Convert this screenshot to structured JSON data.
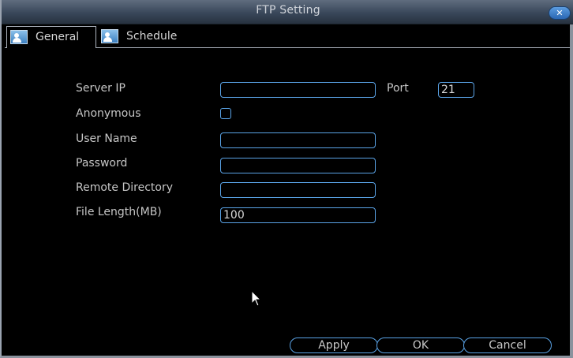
{
  "window": {
    "title": "FTP Setting",
    "close_icon": "✕"
  },
  "tabs": [
    {
      "label": "General",
      "icon": "user-icon"
    },
    {
      "label": "Schedule",
      "icon": "user-icon"
    }
  ],
  "form": {
    "server_ip": {
      "label": "Server IP",
      "value": ""
    },
    "port": {
      "label": "Port",
      "value": "21"
    },
    "anonymous": {
      "label": "Anonymous",
      "checked": false
    },
    "user_name": {
      "label": "User Name",
      "value": ""
    },
    "password": {
      "label": "Password",
      "value": ""
    },
    "remote_directory": {
      "label": "Remote Directory",
      "value": ""
    },
    "file_length": {
      "label": "File Length(MB)",
      "value": "100"
    }
  },
  "buttons": {
    "apply": "Apply",
    "ok": "OK",
    "cancel": "Cancel"
  },
  "colors": {
    "accent": "#5aa3e6",
    "titlebar": "#39475a",
    "background": "#000000"
  }
}
